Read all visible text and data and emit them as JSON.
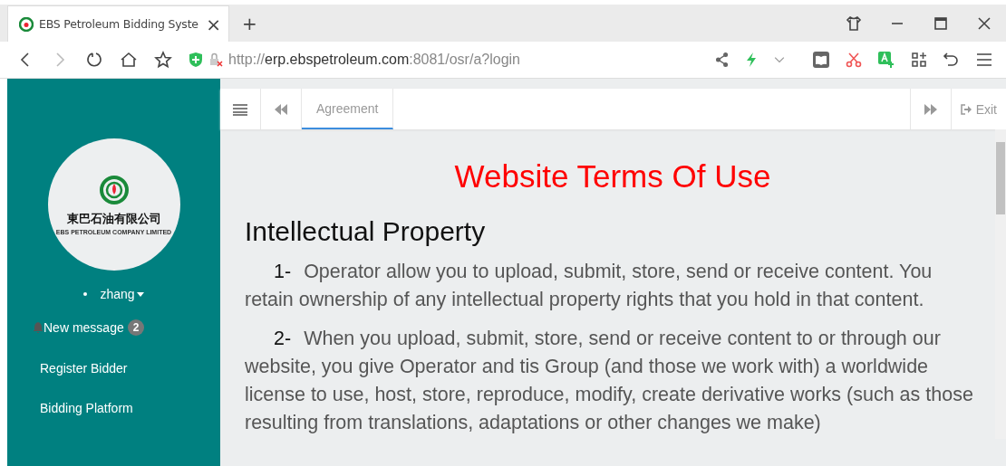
{
  "browser": {
    "tab": {
      "title": "EBS Petroleum Bidding Syste",
      "close": "×",
      "selected": true
    },
    "new_tab": "+",
    "url": {
      "scheme": "http://",
      "host": "erp.ebspetroleum.com",
      "rest": ":8081/osr/a?login"
    }
  },
  "sidebar": {
    "logo": {
      "chinese": "東巴石油有限公司",
      "english": "EBS PETROLEUM COMPANY LIMITED"
    },
    "user": "zhang",
    "message": {
      "label": "New message",
      "count": "2"
    },
    "items": [
      {
        "label": "Register Bidder"
      },
      {
        "label": "Bidding Platform"
      }
    ]
  },
  "tabs": [
    {
      "label": "Agreement",
      "selected": true
    }
  ],
  "exit": "Exit",
  "document": {
    "title": "Website Terms Of Use",
    "heading": "Intellectual Property",
    "paragraphs": [
      {
        "number": "1-",
        "text": "Operator allow you to upload, submit, store, send or receive content. You retain ownership of any intellectual property rights that you hold in that content."
      },
      {
        "number": "2-",
        "text": "When you upload, submit, store, send or receive content to or through our website, you give Operator and tis Group (and those we work with) a worldwide license to use, host, store, reproduce, modify, create derivative works (such as those resulting from translations, adaptations or other changes we make)"
      }
    ]
  }
}
